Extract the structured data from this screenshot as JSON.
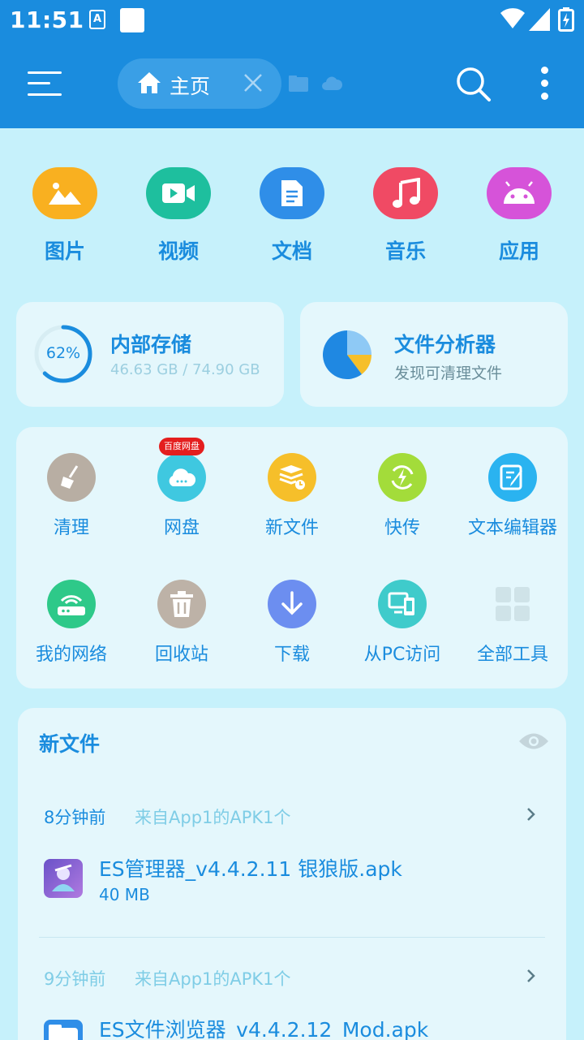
{
  "status_bar": {
    "time": "11:51",
    "notif_icon_letter": "A"
  },
  "header": {
    "active_tab_label": "主页",
    "icons": [
      "menu-icon",
      "home-icon",
      "close-icon",
      "document-icon",
      "cloud-icon",
      "search-icon",
      "more-vert-icon"
    ],
    "bar_color": "#1a8cde"
  },
  "categories": [
    {
      "label": "图片",
      "icon": "image-icon",
      "color": "#f9b020"
    },
    {
      "label": "视频",
      "icon": "video-icon",
      "color": "#1ebf9e"
    },
    {
      "label": "文档",
      "icon": "document-icon",
      "color": "#2f8ee8"
    },
    {
      "label": "音乐",
      "icon": "music-icon",
      "color": "#f04a64"
    },
    {
      "label": "应用",
      "icon": "android-icon",
      "color": "#d653d9"
    }
  ],
  "storage": {
    "percent_label": "62%",
    "percent": 62,
    "title": "内部存储",
    "usage": "46.63 GB / 74.90 GB"
  },
  "analyzer": {
    "title": "文件分析器",
    "subtitle": "发现可清理文件"
  },
  "tools": [
    {
      "label": "清理",
      "icon": "broom-icon",
      "color": "#b8aea3"
    },
    {
      "label": "网盘",
      "icon": "cloud-drive-icon",
      "color": "#3fc8e0",
      "badge": "百度网盘"
    },
    {
      "label": "新文件",
      "icon": "new-files-icon",
      "color": "#f6bf2a"
    },
    {
      "label": "快传",
      "icon": "quick-transfer-icon",
      "color": "#a3dc3a"
    },
    {
      "label": "文本编辑器",
      "icon": "text-editor-icon",
      "color": "#2ab3f0"
    },
    {
      "label": "我的网络",
      "icon": "network-icon",
      "color": "#2ec989"
    },
    {
      "label": "回收站",
      "icon": "recycle-bin-icon",
      "color": "#bdb2a7"
    },
    {
      "label": "下载",
      "icon": "download-icon",
      "color": "#6c8ef0"
    },
    {
      "label": "从PC访问",
      "icon": "pc-access-icon",
      "color": "#3fcbcb"
    },
    {
      "label": "全部工具",
      "icon": "all-tools-icon",
      "color": "#d0e3e8"
    }
  ],
  "new_files": {
    "title": "新文件",
    "groups": [
      {
        "time": "8分钟前",
        "source": "来自App1的APK1个",
        "file_name": "ES管理器_v4.4.2.11 银狼版.apk",
        "file_size": "40 MB"
      },
      {
        "time": "9分钟前",
        "source": "来自App1的APK1个",
        "file_name": "ES文件浏览器_v4.4.2.12_Mod.apk",
        "file_size": ""
      }
    ]
  }
}
